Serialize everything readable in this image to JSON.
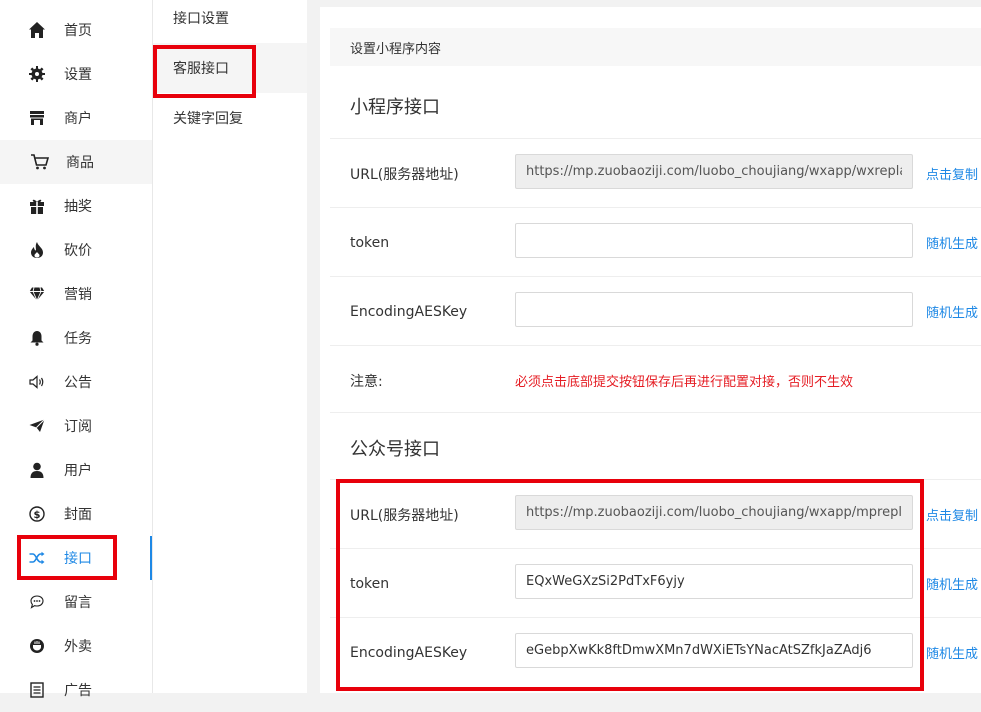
{
  "sidebar": {
    "items": [
      {
        "label": "首页",
        "icon": "home-icon"
      },
      {
        "label": "设置",
        "icon": "gear-icon"
      },
      {
        "label": "商户",
        "icon": "store-icon"
      },
      {
        "label": "商品",
        "icon": "cart-icon"
      },
      {
        "label": "抽奖",
        "icon": "gift-icon"
      },
      {
        "label": "砍价",
        "icon": "fire-icon"
      },
      {
        "label": "营销",
        "icon": "diamond-icon"
      },
      {
        "label": "任务",
        "icon": "bell-icon"
      },
      {
        "label": "公告",
        "icon": "speaker-icon"
      },
      {
        "label": "订阅",
        "icon": "paper-plane-icon"
      },
      {
        "label": "用户",
        "icon": "user-icon"
      },
      {
        "label": "封面",
        "icon": "dollar-icon"
      },
      {
        "label": "接口",
        "icon": "shuffle-icon"
      },
      {
        "label": "留言",
        "icon": "chat-icon"
      },
      {
        "label": "外卖",
        "icon": "takeout-icon"
      },
      {
        "label": "广告",
        "icon": "ad-icon"
      }
    ],
    "active_index": 12
  },
  "subsidebar": {
    "items": [
      {
        "label": "接口设置"
      },
      {
        "label": "客服接口"
      },
      {
        "label": "关键字回复"
      }
    ],
    "active_index": 1
  },
  "main": {
    "header": "设置小程序内容",
    "miniprogram": {
      "title": "小程序接口",
      "url_label": "URL(服务器地址)",
      "url_value": "https://mp.zuobaoziji.com/luobo_choujiang/wxapp/wxreplay.html",
      "url_action": "点击复制",
      "token_label": "token",
      "token_value": "",
      "token_action": "随机生成",
      "aes_label": "EncodingAESKey",
      "aes_value": "",
      "aes_action": "随机生成",
      "notice_label": "注意:",
      "notice_text": "必须点击底部提交按钮保存后再进行配置对接，否则不生效"
    },
    "official": {
      "title": "公众号接口",
      "url_label": "URL(服务器地址)",
      "url_value": "https://mp.zuobaoziji.com/luobo_choujiang/wxapp/mpreplay.html",
      "url_action": "点击复制",
      "token_label": "token",
      "token_value": "EQxWeGXzSi2PdTxF6yjy",
      "token_action": "随机生成",
      "aes_label": "EncodingAESKey",
      "aes_value": "eGebpXwKk8ftDmwXMn7dWXiETsYNacAtSZfkJaZAdj6",
      "aes_action": "随机生成"
    }
  },
  "colors": {
    "accent": "#1e88e5",
    "highlight": "#e8000b",
    "warning": "#e51c23"
  }
}
